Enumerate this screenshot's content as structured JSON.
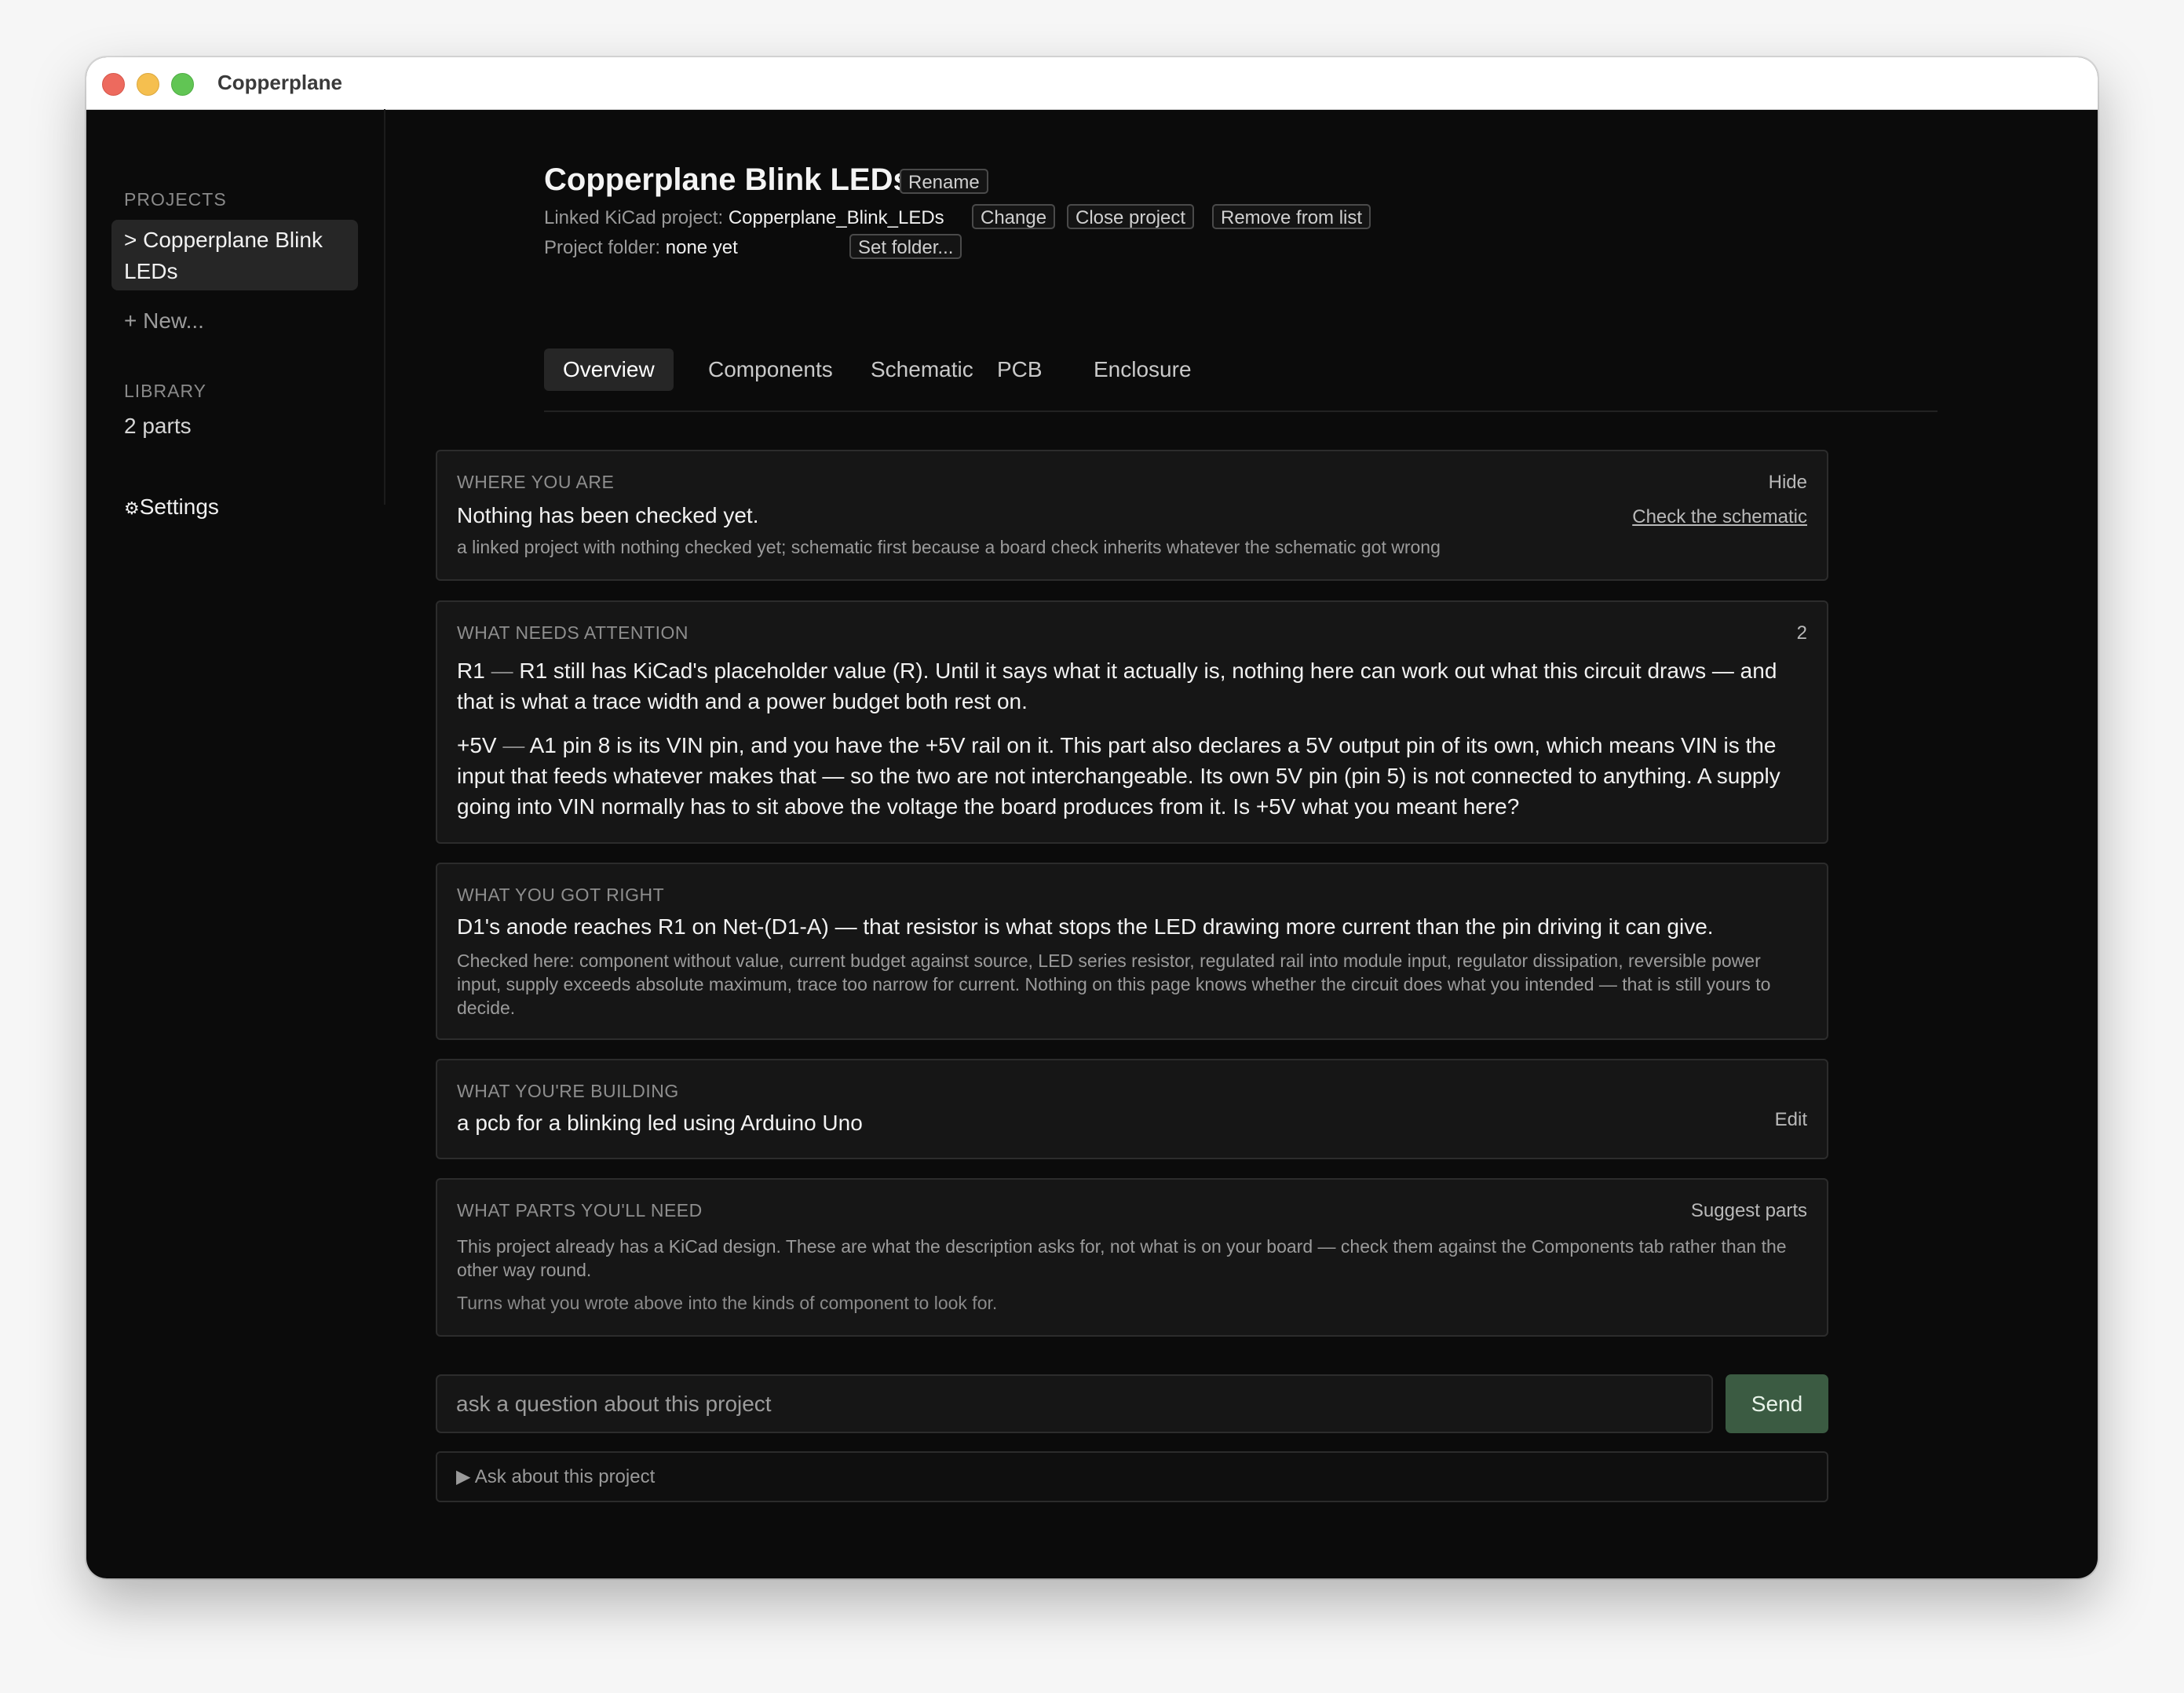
{
  "window": {
    "title": "Copperplane"
  },
  "sidebar": {
    "projects_heading": "PROJECTS",
    "active_project": "> Copperplane Blink LEDs",
    "new_label": "+ New...",
    "library_heading": "LIBRARY",
    "library_count": "2 parts",
    "settings_icon": "⚙",
    "settings_label": "Settings"
  },
  "project": {
    "title": "Copperplane Blink LEDs",
    "rename_label": "Rename",
    "linked_label": "Linked KiCad project:",
    "linked_value": "Copperplane_Blink_LEDs",
    "change_label": "Change",
    "close_label": "Close project",
    "remove_label": "Remove from list",
    "folder_label": "Project folder:",
    "folder_value": "none yet",
    "set_folder_label": "Set folder..."
  },
  "tabs": [
    "Overview",
    "Components",
    "Schematic",
    "PCB",
    "Enclosure"
  ],
  "active_tab": "Overview",
  "cards": {
    "where": {
      "heading": "WHERE YOU ARE",
      "hide_label": "Hide",
      "status": "Nothing has been checked yet.",
      "action": "Check the schematic",
      "note": "a linked project with nothing checked yet; schematic first because a board check inherits whatever the schematic got wrong"
    },
    "attention": {
      "heading": "WHAT NEEDS ATTENTION",
      "count": "2",
      "items": [
        {
          "ref": "R1",
          "sep": " — ",
          "text": "R1 still has KiCad's placeholder value (R). Until it says what it actually is, nothing here can work out what this circuit draws — and that is what a trace width and a power budget both rest on."
        },
        {
          "ref": "+5V",
          "sep": " — ",
          "text": "A1 pin 8 is its VIN pin, and you have the +5V rail on it. This part also declares a 5V output pin of its own, which means VIN is the input that feeds whatever makes that — so the two are not interchangeable. Its own 5V pin (pin 5) is not connected to anything. A supply going into VIN normally has to sit above the voltage the board produces from it. Is +5V what you meant here?"
        }
      ]
    },
    "right": {
      "heading": "WHAT YOU GOT RIGHT",
      "text": "D1's anode reaches R1 on Net-(D1-A) — that resistor is what stops the LED drawing more current than the pin driving it can give.",
      "note": "Checked here: component without value, current budget against source, LED series resistor, regulated rail into module input, regulator dissipation, reversible power input, supply exceeds absolute maximum, trace too narrow for current. Nothing on this page knows whether the circuit does what you intended — that is still yours to decide."
    },
    "building": {
      "heading": "WHAT YOU'RE BUILDING",
      "text": "a pcb for a blinking led using Arduino Uno",
      "edit_label": "Edit"
    },
    "parts": {
      "heading": "WHAT PARTS YOU'LL NEED",
      "suggest_label": "Suggest parts",
      "warning": "This project already has a KiCad design. These are what the description asks for, not what is on your board — check them against the Components tab rather than the other way round.",
      "note": "Turns what you wrote above into the kinds of component to look for."
    }
  },
  "ask": {
    "placeholder": "ask a question about this project",
    "send_label": "Send",
    "expander_label": "▶ Ask about this project"
  },
  "colors": {
    "window_bg": "#0b0b0b",
    "card_bg": "#161616",
    "send_bg": "#3b5b42",
    "warning": "#e6b24c"
  }
}
